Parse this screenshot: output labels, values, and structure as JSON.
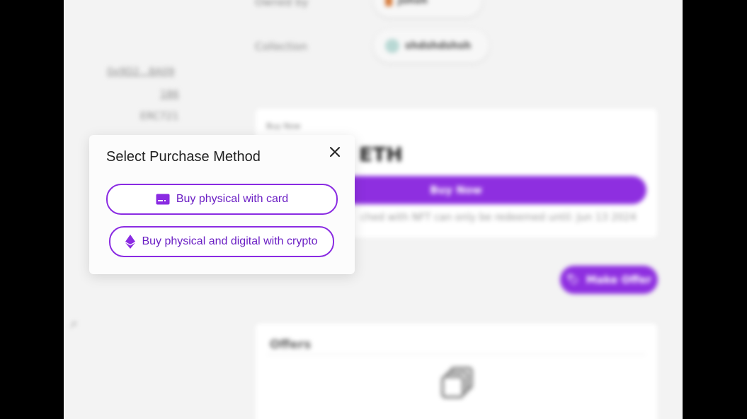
{
  "details": {
    "owned_by_label": "Owned by",
    "owner_name": "Jshsh",
    "collection_label": "Collection",
    "collection_name": "shdshdshsh",
    "contract_address": "0x9D2...8A09",
    "token_id": "186",
    "token_standard": "ERC721"
  },
  "buy_card": {
    "label": "Buy Now",
    "price_suffix": "ETH",
    "buy_button": "Buy Now",
    "note": "ched with NFT can only be redeemed until: Jun 13 2024"
  },
  "make_offer_button": "Make Offer",
  "offers": {
    "title": "Offers"
  },
  "modal": {
    "title": "Select Purchase Method",
    "card_option": "Buy physical with card",
    "crypto_option": "Buy physical and digital with crypto"
  },
  "colors": {
    "accent": "#8e2fe0",
    "option_border": "#8a2be2"
  },
  "icons": {
    "card": "credit-card-icon",
    "crypto": "ethereum-icon",
    "close": "close-icon",
    "offers": "cards-stack-icon"
  }
}
